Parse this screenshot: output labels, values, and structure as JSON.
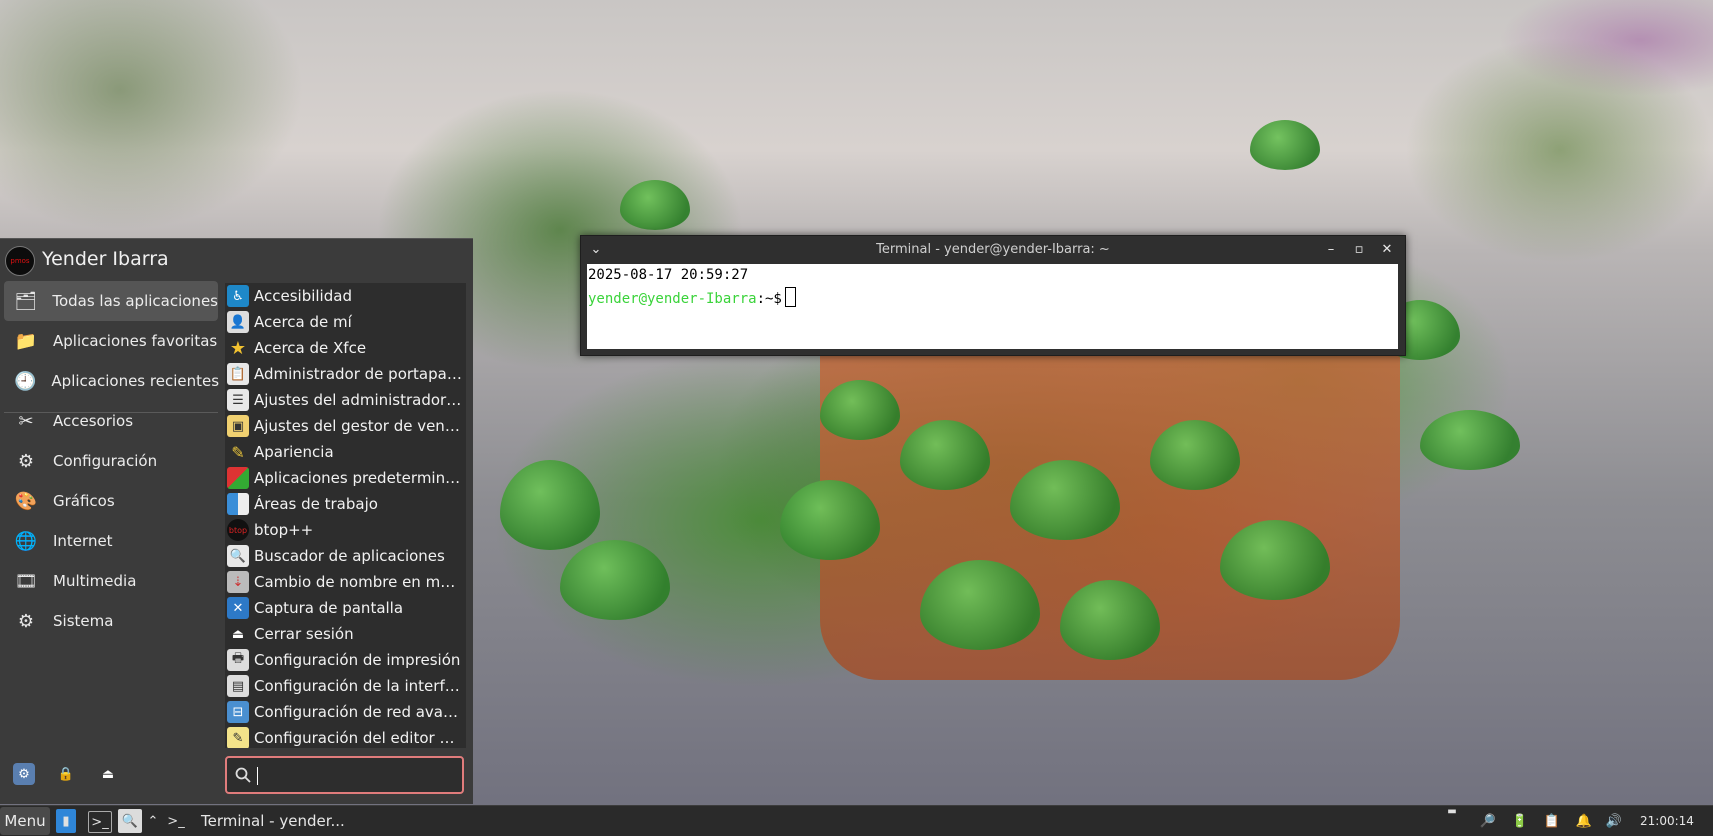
{
  "user": {
    "name": "Yender Ibarra",
    "avatar_text": "pmos"
  },
  "categories": [
    {
      "label": "Todas las aplicaciones",
      "icon": "all-apps-icon"
    },
    {
      "label": "Aplicaciones favoritas",
      "icon": "favorites-icon"
    },
    {
      "label": "Aplicaciones recientes",
      "icon": "recent-icon"
    },
    {
      "label": "Accesorios",
      "icon": "accessories-icon"
    },
    {
      "label": "Configuración",
      "icon": "settings-icon"
    },
    {
      "label": "Gráficos",
      "icon": "graphics-icon"
    },
    {
      "label": "Internet",
      "icon": "internet-icon"
    },
    {
      "label": "Multimedia",
      "icon": "multimedia-icon"
    },
    {
      "label": "Sistema",
      "icon": "system-icon"
    }
  ],
  "apps": [
    {
      "label": "Accesibilidad",
      "icon": "accessibility-icon"
    },
    {
      "label": "Acerca de mí",
      "icon": "about-me-icon"
    },
    {
      "label": "Acerca de Xfce",
      "icon": "star-icon"
    },
    {
      "label": "Administrador de portapap…",
      "icon": "clipboard-icon"
    },
    {
      "label": "Ajustes del administrador d…",
      "icon": "settings-manager-icon"
    },
    {
      "label": "Ajustes del gestor de venta…",
      "icon": "window-manager-icon"
    },
    {
      "label": "Apariencia",
      "icon": "appearance-icon"
    },
    {
      "label": "Aplicaciones predetermina…",
      "icon": "default-apps-icon"
    },
    {
      "label": "Áreas de trabajo",
      "icon": "workspaces-icon"
    },
    {
      "label": "btop++",
      "icon": "btop-icon"
    },
    {
      "label": "Buscador de aplicaciones",
      "icon": "app-finder-icon"
    },
    {
      "label": "Cambio de nombre en masa",
      "icon": "bulk-rename-icon"
    },
    {
      "label": "Captura de pantalla",
      "icon": "screenshot-icon"
    },
    {
      "label": "Cerrar sesión",
      "icon": "logout-icon"
    },
    {
      "label": "Configuración de impresión",
      "icon": "printer-icon"
    },
    {
      "label": "Configuración de la interfaz…",
      "icon": "interface-settings-icon"
    },
    {
      "label": "Configuración de red avanz…",
      "icon": "network-settings-icon"
    },
    {
      "label": "Configuración del editor de…",
      "icon": "editor-settings-icon"
    }
  ],
  "search": {
    "placeholder": "",
    "value": ""
  },
  "terminal": {
    "title": "Terminal - yender@yender-Ibarra: ~",
    "line1": "2025-08-17 20:59:27",
    "prompt_user": "yender@yender-Ibarra",
    "prompt_rest": ":~$"
  },
  "panel": {
    "menu_label": "Menu",
    "task_label": "Terminal - yender...",
    "clock": "21:00:14"
  },
  "colors": {
    "menu_bg": "#3b3b3b",
    "list_bg": "#2d2d2d",
    "search_border": "#e07c7c",
    "prompt_green": "#3ad33a",
    "panel_bg": "#2a2a2a"
  }
}
